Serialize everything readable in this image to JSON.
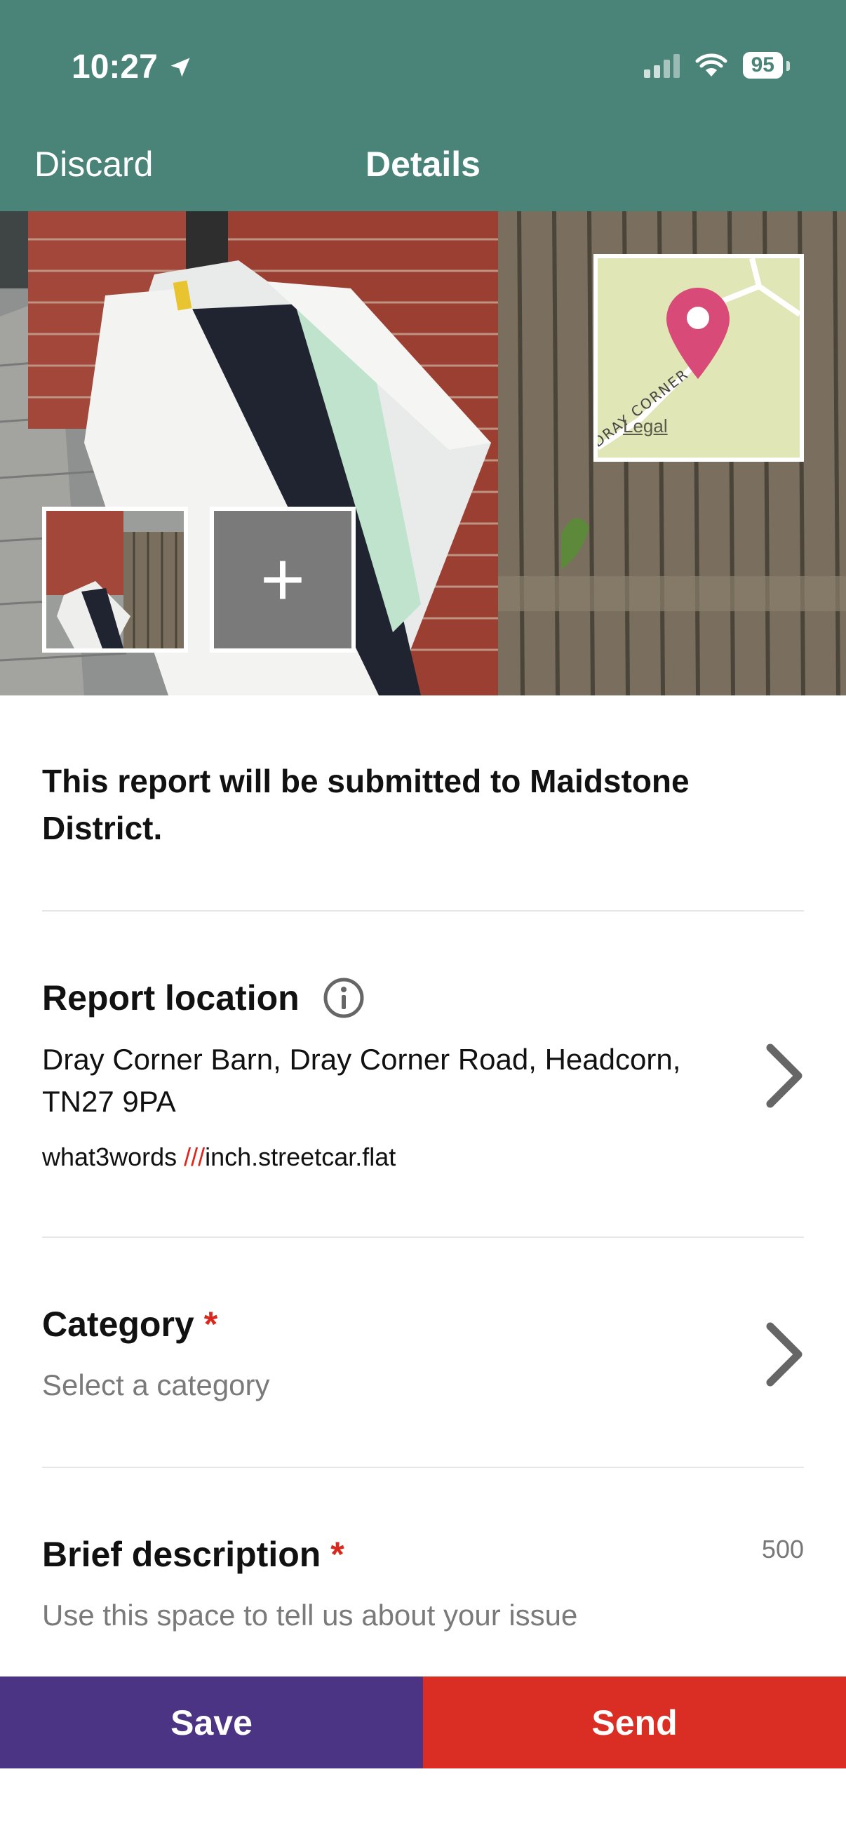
{
  "status_bar": {
    "time": "10:27",
    "battery": "95"
  },
  "nav": {
    "discard_label": "Discard",
    "title": "Details"
  },
  "photo": {
    "add_symbol": "+",
    "map_legal": "Legal",
    "map_road_label": "DRAY CORNER RD"
  },
  "notice": "This report will be submitted to Maidstone District.",
  "location": {
    "title": "Report location",
    "address": "Dray Corner Barn, Dray Corner Road, Headcorn, TN27 9PA",
    "w3w_prefix": "what3words ",
    "w3w_slashes": "///",
    "w3w_words": "inch.streetcar.flat"
  },
  "category": {
    "title": "Category",
    "required_mark": "*",
    "placeholder": "Select a category"
  },
  "description": {
    "title": "Brief description",
    "required_mark": "*",
    "char_limit": "500",
    "placeholder": "Use this space to tell us about your issue"
  },
  "actions": {
    "save_label": "Save",
    "send_label": "Send"
  },
  "colors": {
    "header": "#4a8478",
    "save": "#4c3485",
    "send": "#da2d24",
    "required": "#d9291f",
    "map_pin": "#d84a78"
  },
  "icons": [
    "location-arrow-icon",
    "signal-icon",
    "wifi-icon",
    "battery-icon",
    "plus-icon",
    "map-pin-icon",
    "info-icon",
    "chevron-right-icon"
  ]
}
